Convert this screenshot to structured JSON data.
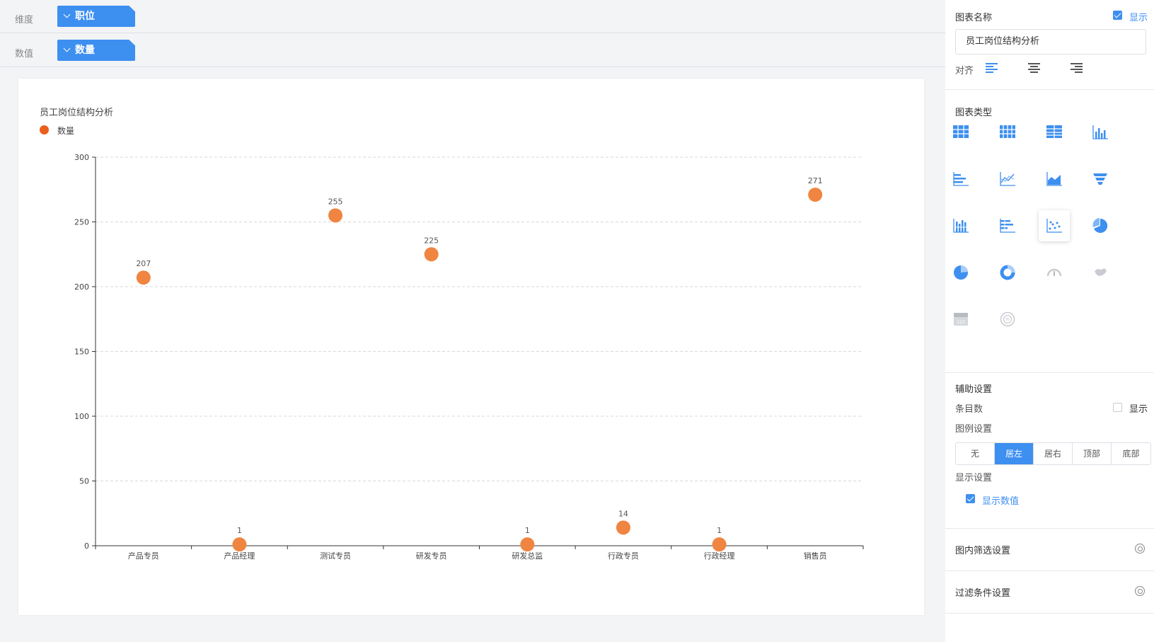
{
  "fields": {
    "dimension_label": "维度",
    "dimension_value": "职位",
    "measure_label": "数值",
    "measure_value": "数量"
  },
  "chart_data": {
    "type": "scatter",
    "title": "员工岗位结构分析",
    "legend": "数量",
    "legend_position": "top-left",
    "categories": [
      "产品专员",
      "产品经理",
      "测试专员",
      "研发专员",
      "研发总监",
      "行政专员",
      "行政经理",
      "销售员"
    ],
    "series": [
      {
        "name": "数量",
        "values": [
          207,
          1,
          255,
          225,
          1,
          14,
          1,
          271
        ],
        "color": "#ef8540"
      }
    ],
    "yticks": [
      0,
      50,
      100,
      150,
      200,
      250,
      300
    ],
    "ylim": [
      0,
      300
    ],
    "grid": true,
    "show_values": true
  },
  "panel": {
    "chart_name_label": "图表名称",
    "show_label": "显示",
    "chart_name_value": "员工岗位结构分析",
    "align_label": "对齐",
    "chart_type_label": "图表类型",
    "chart_type_icons": [
      "table-icon",
      "cross-table-icon",
      "summary-table-icon",
      "column-chart-icon",
      "bar-chart-icon",
      "line-chart-icon",
      "area-chart-icon",
      "funnel-chart-icon",
      "stacked-column-icon",
      "stacked-bar-icon",
      "scatter-chart-icon",
      "pie-chart-icon",
      "pie-chart-2-icon",
      "donut-chart-icon",
      "gauge-icon",
      "map-icon",
      "kpi-card-icon",
      "word-cloud-icon"
    ],
    "aux_label": "辅助设置",
    "item_count_label": "条目数",
    "item_count_show": "显示",
    "legend_settings_label": "图例设置",
    "legend_options": [
      "无",
      "居左",
      "居右",
      "顶部",
      "底部"
    ],
    "legend_selected": "居左",
    "display_settings_label": "显示设置",
    "show_values_label": "显示数值",
    "inner_filter_label": "图内筛选设置",
    "filter_condition_label": "过滤条件设置",
    "accent_color": "#3d8ff0"
  }
}
